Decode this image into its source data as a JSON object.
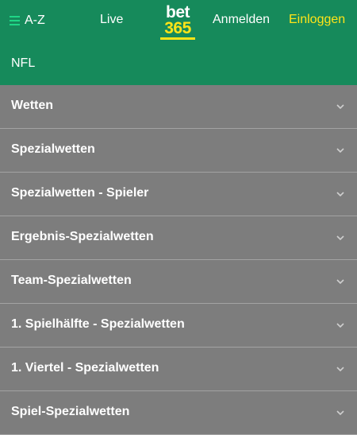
{
  "header": {
    "menu_label": "A-Z",
    "live_label": "Live",
    "logo_top": "bet",
    "logo_bottom": "365",
    "register_label": "Anmelden",
    "login_label": "Einloggen",
    "colors": {
      "green": "#168a5b",
      "yellow": "#ffe418",
      "accent": "#1fd686"
    }
  },
  "subheader": {
    "title": "NFL"
  },
  "market_list": {
    "background": "#7d7d7d",
    "items": [
      {
        "label": "Wetten",
        "icon": "chevron-down-icon"
      },
      {
        "label": "Spezialwetten",
        "icon": "chevron-down-icon"
      },
      {
        "label": "Spezialwetten - Spieler",
        "icon": "chevron-down-icon"
      },
      {
        "label": "Ergebnis-Spezialwetten",
        "icon": "chevron-down-icon"
      },
      {
        "label": "Team-Spezialwetten",
        "icon": "chevron-down-icon"
      },
      {
        "label": "1. Spielhälfte - Spezialwetten",
        "icon": "chevron-down-icon"
      },
      {
        "label": "1. Viertel - Spezialwetten",
        "icon": "chevron-down-icon"
      },
      {
        "label": "Spiel-Spezialwetten",
        "icon": "chevron-down-icon"
      }
    ]
  }
}
